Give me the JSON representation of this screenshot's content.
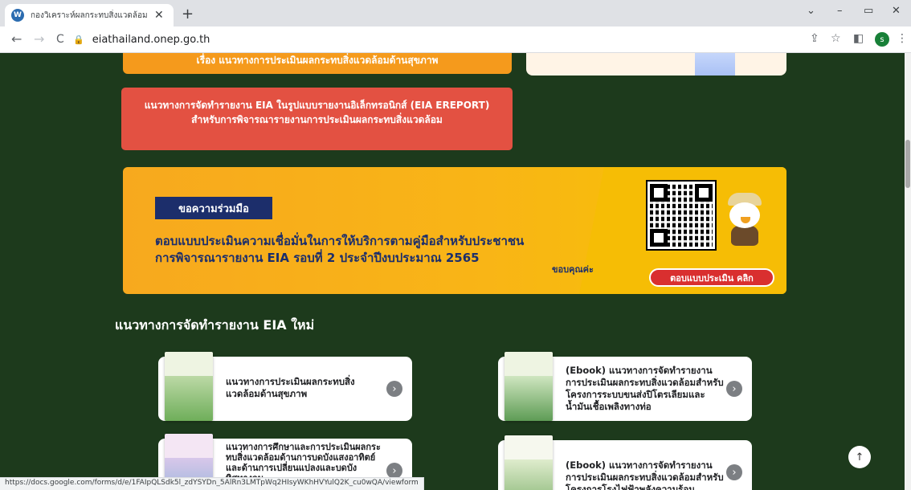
{
  "browser": {
    "tab_title": "กองวิเคราะห์ผลกระทบสิ่งแวดล้อม (กวผ.",
    "tab_close": "✕",
    "new_tab": "+",
    "favicon": "W",
    "url": "eiathailand.onep.go.th",
    "profile_initial": "s",
    "win_minimize": "–",
    "win_restore": "▭",
    "win_close": "✕",
    "win_dropdown": "⌄",
    "back": "←",
    "forward": "→",
    "reload": "C",
    "lock": "🔒",
    "share": "⇪",
    "star": "☆",
    "sidepanel": "◧",
    "menu": "⋮"
  },
  "page": {
    "orange_banner_text": "เรื่อง แนวทางการประเมินผลกระทบสิ่งแวดล้อมด้านสุขภาพ",
    "red_banner": {
      "line1": "แนวทางการจัดทำรายงาน EIA ในรูปแบบรายงานอิเล็กทรอนิกส์ (EIA EREPORT)",
      "line2": "สำหรับการพิจารณารายงานการประเมินผลกระทบสิ่งแวดล้อม"
    },
    "survey": {
      "tag": "ขอความร่วมมือ",
      "line1": "ตอบแบบประเมินความเชื่อมั่นในการให้บริการตามคู่มือสำหรับประชาชน",
      "line2": "การพิจารณารายงาน EIA รอบที่ 2 ประจำปีงบประมาณ 2565",
      "thanks": "ขอบคุณค่ะ",
      "button": "ตอบแบบประเมิน คลิก"
    },
    "section_title": "แนวทางการจัดทำรายงาน EIA ใหม่",
    "cards": [
      {
        "text": "แนวทางการประเมินผลกระทบสิ่งแวดล้อมด้านสุขภาพ"
      },
      {
        "text": "(Ebook) แนวทางการจัดทำรายงานการประเมินผลกระทบสิ่งแวดล้อมสำหรับโครงการระบบขนส่งปิโตรเลียมและน้ำมันเชื้อเพลิงทางท่อ"
      },
      {
        "text": "แนวทางการศึกษาและการประเมินผลกระทบสิ่งแวดล้อมด้านการบดบังแสงอาทิตย์และด้านการเปลี่ยนแปลงและบดบังทิศทางลม"
      },
      {
        "text": "(Ebook) แนวทางการจัดทำรายงานการประเมินผลกระทบสิ่งแวดล้อมสำหรับโครงการโรงไฟฟ้าพลังความร้อน"
      }
    ],
    "card_arrow": "›",
    "back_to_top": "↑",
    "status_url": "https://docs.google.com/forms/d/e/1FAIpQLSdk5l_zdYSYDn_5AlRn3LMTpWq2HIsyWKhHVYulQ2K_cu0wQA/viewform"
  }
}
